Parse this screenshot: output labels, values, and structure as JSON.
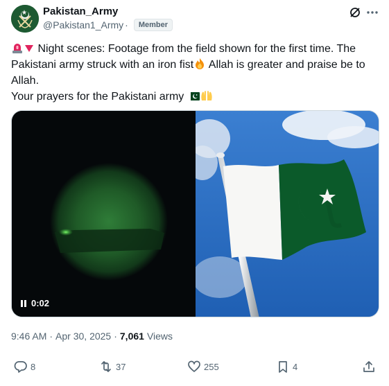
{
  "author": {
    "name": "Pakistan_Army",
    "handle": "@Pakistan1_Army",
    "separator": "·",
    "badge": "Member"
  },
  "tweet": {
    "line1": "Night scenes: Footage from the field shown for the first time.  The Pakistani army struck with an iron fist",
    "line2": "  Allah is greater and praise be to Allah.",
    "line3": "Your prayers for the Pakistani army",
    "emojis": [
      "rotating-light",
      "red-triangle-down",
      "fire",
      "flag-pakistan",
      "raised-hands"
    ]
  },
  "media": {
    "video_time": "0:02",
    "left_desc_icon": "play-pause-icon"
  },
  "meta": {
    "time": "9:46 AM",
    "dot": "·",
    "date": "Apr 30, 2025",
    "views_count": "7,061",
    "views_label": "Views"
  },
  "actions": {
    "replies": "8",
    "reposts": "37",
    "likes": "255",
    "bookmarks": "4"
  },
  "colors": {
    "text": "#0f1419",
    "secondary": "#536471",
    "flag_green": "#01411c",
    "night_green": "#3fa84a"
  }
}
